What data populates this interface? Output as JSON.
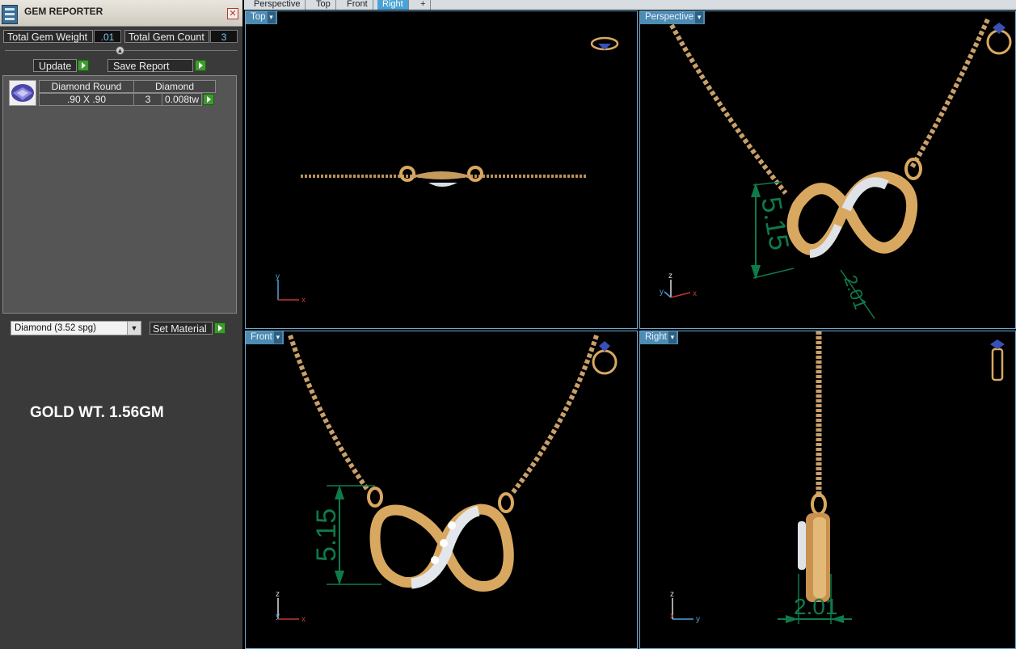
{
  "gem_reporter": {
    "title": "GEM REPORTER",
    "close": "✕",
    "total_gem_weight_label": "Total Gem Weight",
    "total_gem_weight_value": ".01",
    "total_gem_count_label": "Total Gem Count",
    "total_gem_count_value": "3",
    "update_label": "Update",
    "save_report_label": "Save Report",
    "gem": {
      "shape": "Diamond Round",
      "material": "Diamond",
      "size": ".90 X .90",
      "count": "3",
      "weight": "0.008tw"
    },
    "material_select": "Diamond     (3.52 spg)",
    "set_material_label": "Set Material",
    "gold_weight_note": "GOLD WT. 1.56GM"
  },
  "tabs": [
    {
      "label": "Perspective",
      "active": false
    },
    {
      "label": "Top",
      "active": false
    },
    {
      "label": "Front",
      "active": false
    },
    {
      "label": "Right",
      "active": true
    },
    {
      "label": "+",
      "active": false
    }
  ],
  "viewports": {
    "top": {
      "label": "Top"
    },
    "perspective": {
      "label": "Perspective",
      "dimension_height": "5.15",
      "dimension_depth": "2.01"
    },
    "front": {
      "label": "Front",
      "dimension_height": "5.15"
    },
    "right": {
      "label": "Right",
      "dimension_depth": "2.01"
    }
  },
  "axes": {
    "x": "x",
    "y": "y",
    "z": "z"
  },
  "colors": {
    "viewport_border": "#6fa9cc",
    "tab_active": "#4aa3d6",
    "dimension": "#0f7a4a",
    "gold": "#d9a860",
    "axis_x": "#c0392b",
    "axis_y": "#4da3d9",
    "axis_z": "#dddddd"
  }
}
